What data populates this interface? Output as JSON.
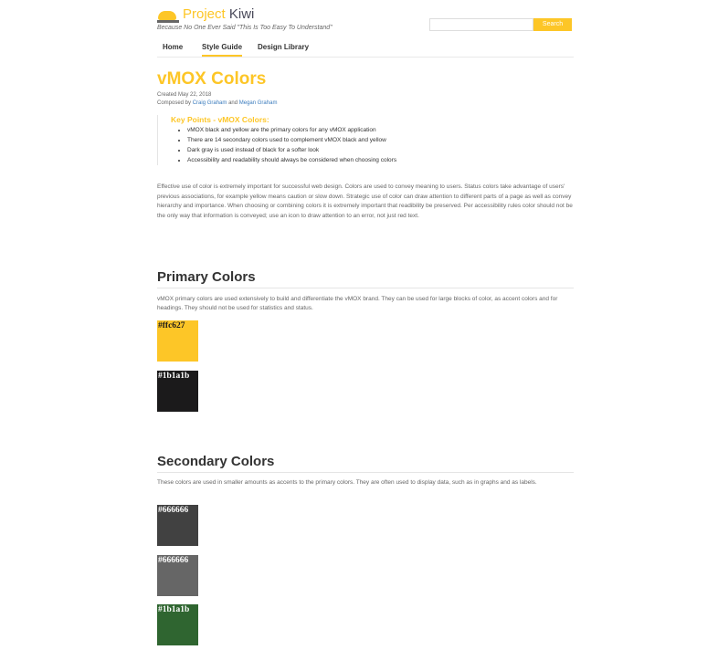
{
  "header": {
    "logo_part1": "Project",
    "logo_part2": "Kiwi",
    "tagline": "Because No One Ever Said \"This Is Too Easy To Understand\"",
    "search_placeholder": "",
    "search_button": "Search"
  },
  "nav": [
    {
      "label": "Home"
    },
    {
      "label": "Style Guide"
    },
    {
      "label": "Design Library"
    }
  ],
  "page": {
    "title": "vMOX Colors",
    "created": "Created May 22, 2018",
    "composed_prefix": "Composed by",
    "author1": "Craig Graham",
    "and": "and",
    "author2": "Megan Graham"
  },
  "key_points": {
    "title": "Key Points - vMOX Colors:",
    "items": [
      "vMOX black and yellow are the primary colors for any vMOX application",
      "There are 14 secondary colors used to complement vMOX black and yellow",
      "Dark gray is used instead of black for a softer look",
      "Accessibility and readability should always be considered when choosing colors"
    ]
  },
  "intro": "Effective use of color is extremely important for successful web design. Colors are used to convey meaning to users. Status colors take advantage of users' previous associations, for example yellow means caution or slow down. Strategic use of color can draw attention to different parts of a page as well as convey hierarchy and importance. When choosing or combining colors it is extremely important that readibility be preserved. Per accessibility rules color should not be the only way that information is conveyed; use an icon to draw attention to an error, not just red text.",
  "primary": {
    "title": "Primary Colors",
    "description": "vMOX primary colors are used extensively to build and differentiate the vMOX brand. They can be used for large blocks of color, as accent colors and for headings. They should not be used for statistics and status.",
    "swatches": [
      {
        "label": "#ffc627",
        "color": "#fdc627",
        "text_color": "#1b1a1b"
      },
      {
        "label": "#1b1a1b",
        "color": "#1b1a1b",
        "text_color": "#ffffff"
      }
    ]
  },
  "secondary": {
    "title": "Secondary Colors",
    "description": "These colors are used in smaller amounts as accents to the primary colors. They are often used to display data, such as in graphs and as labels.",
    "swatches": [
      {
        "label": "#666666",
        "color": "#414141",
        "text_color": "#ffffff"
      },
      {
        "label": "#666666",
        "color": "#666666",
        "text_color": "#ffffff"
      },
      {
        "label": "#1b1a1b",
        "color": "#2f6530",
        "text_color": "#ffffff"
      }
    ]
  }
}
